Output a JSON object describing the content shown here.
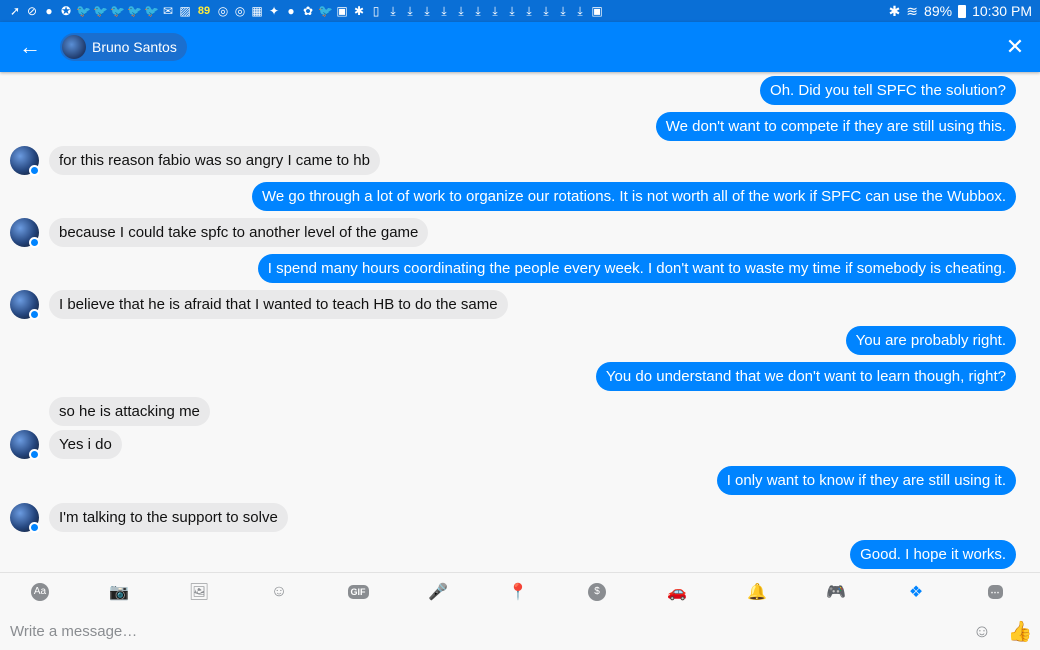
{
  "status_bar": {
    "notification_icons": [
      "➚",
      "⊘",
      "●",
      "✪",
      "🐦",
      "🐦",
      "🐦",
      "🐦",
      "🐦",
      "✉",
      "▨",
      "89",
      "◎",
      "◎",
      "▦",
      "✦",
      "●",
      "✿",
      "🐦",
      "▣",
      "✱",
      "▯",
      "⤓",
      "⤓",
      "⤓",
      "⤓",
      "⤓",
      "⤓",
      "⤓",
      "⤓",
      "⤓",
      "⤓",
      "⤓",
      "⤓",
      "▣"
    ],
    "bluetooth_icon": "✱",
    "wifi_icon": "≋",
    "battery": "89%",
    "time": "10:30 PM"
  },
  "header": {
    "back_icon": "←",
    "contact_name": "Bruno Santos",
    "close_icon": "✕"
  },
  "messages": [
    {
      "side": "out",
      "text": "Oh. Did you tell SPFC the solution?"
    },
    {
      "side": "out",
      "text": "We don't want to compete if they are still using this."
    },
    {
      "side": "in",
      "text": "for this reason fabio was so angry I came to hb",
      "avatar": true
    },
    {
      "side": "out",
      "text": "We go through a lot of work to organize our rotations. It is not worth all of the work if SPFC can use the Wubbox."
    },
    {
      "side": "in",
      "text": "because I could take spfc to another level of the game",
      "avatar": true
    },
    {
      "side": "out",
      "text": "I spend many hours coordinating the people  every week. I don't want to waste my time if somebody is cheating."
    },
    {
      "side": "in",
      "text": "I believe that he is afraid that I wanted to teach HB to do the same",
      "avatar": true
    },
    {
      "side": "out",
      "text": "You are probably right."
    },
    {
      "side": "out",
      "text": "You do understand that we don't want to learn though, right?"
    },
    {
      "side": "in",
      "text": "so he is attacking me",
      "avatar": false
    },
    {
      "side": "in",
      "text": "Yes i do",
      "avatar": true
    },
    {
      "side": "out",
      "text": "I only want to know if they are still using it."
    },
    {
      "side": "in",
      "text": "I'm talking to the support to solve",
      "avatar": true
    },
    {
      "side": "out",
      "text": "Good. I hope it works."
    }
  ],
  "toolbar": {
    "text_icon": "Aa",
    "camera_icon": "📷",
    "gallery_icon": "🖼",
    "emoji_icon": "☺",
    "gif_icon": "GIF",
    "mic_icon": "🎤",
    "location_icon": "📍",
    "payment_icon": "$",
    "car_icon": "🚗",
    "bell_icon": "🔔",
    "game_icon": "🎮",
    "dropbox_icon": "❖",
    "more_icon": "⋯"
  },
  "composer": {
    "placeholder": "Write a message…",
    "sticker_icon": "☺",
    "like_icon": "👍"
  },
  "colors": {
    "accent": "#0084ff",
    "status_bar": "#0a6fd6",
    "incoming_bubble": "#e9e9ea"
  }
}
